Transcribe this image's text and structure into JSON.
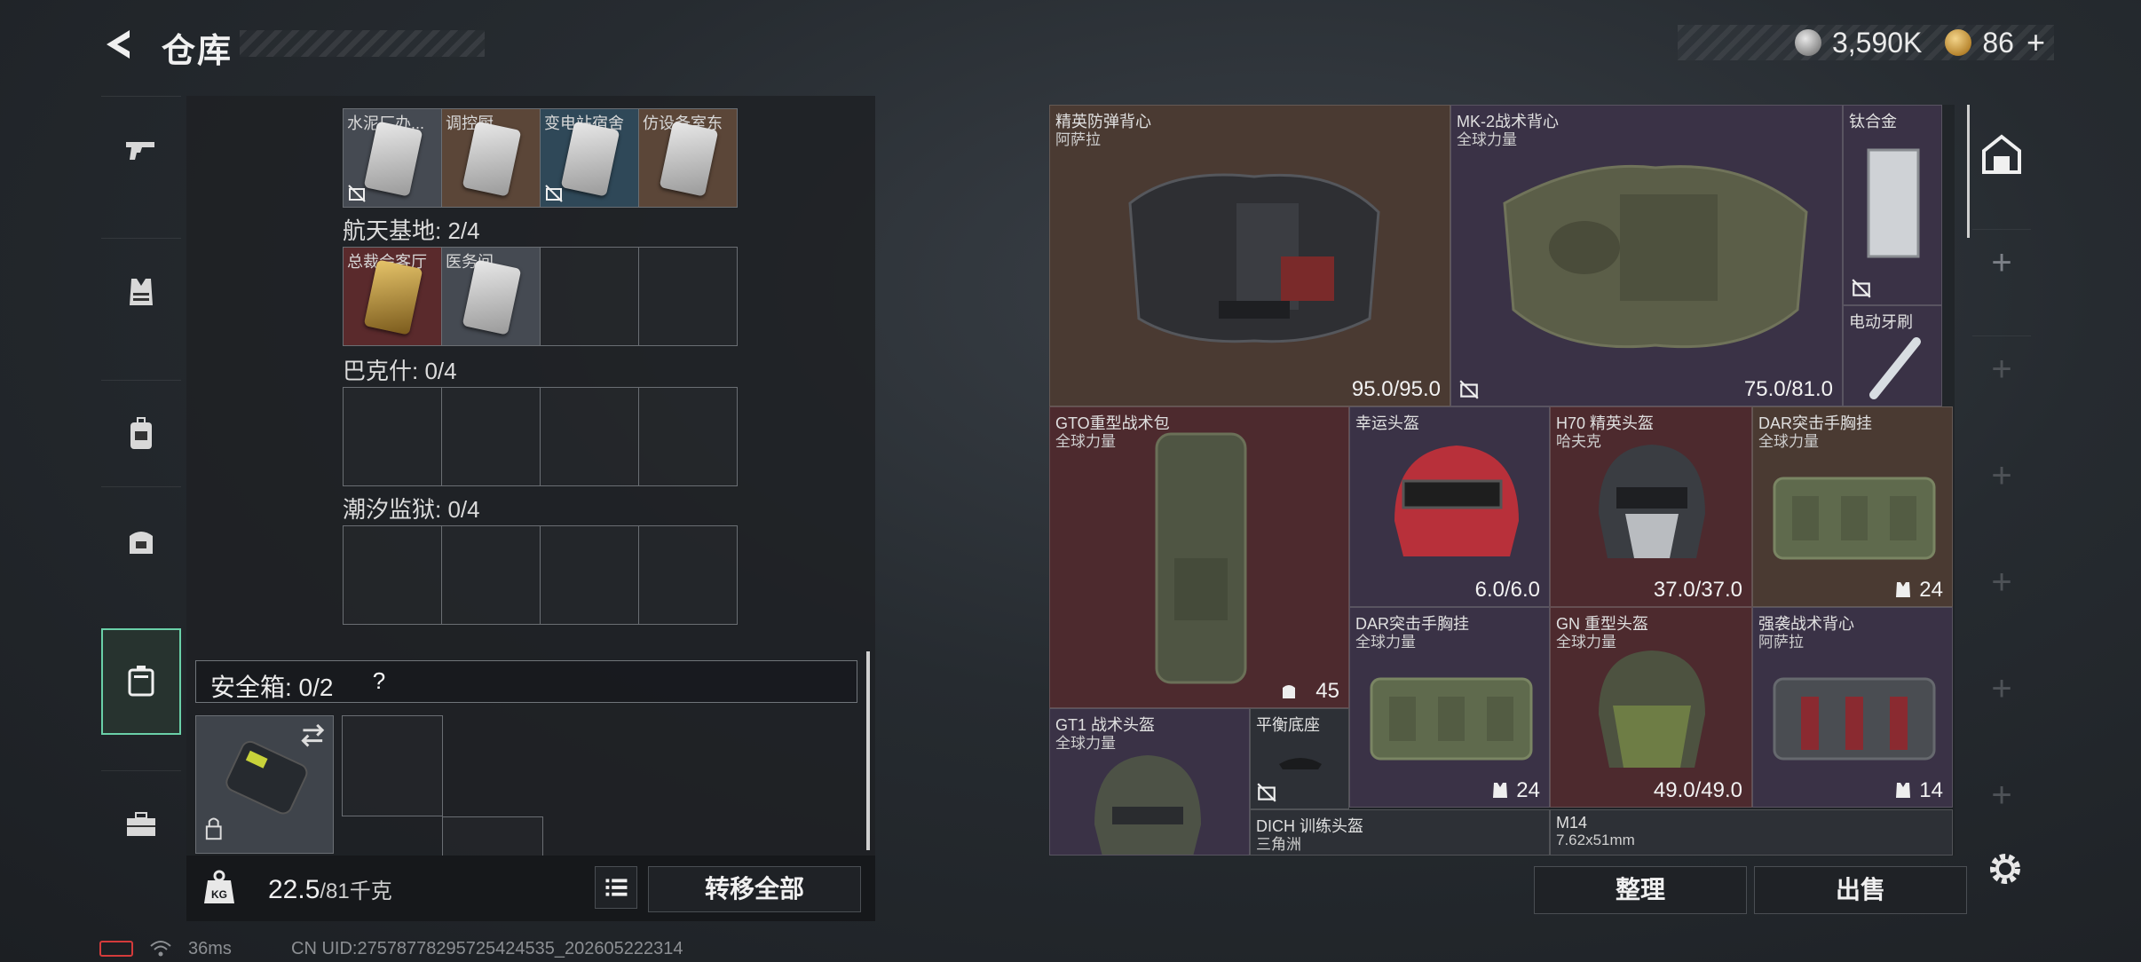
{
  "header": {
    "title": "仓库",
    "currency_silver": "3,590K",
    "currency_gold": "86",
    "currency_plus": "+"
  },
  "sidebar": {
    "items": [
      {
        "icon": "pistol-icon"
      },
      {
        "icon": "vest-icon"
      },
      {
        "icon": "backpack-icon"
      },
      {
        "icon": "bag-icon"
      },
      {
        "icon": "safe-box-icon",
        "active": true
      },
      {
        "icon": "toolbox-icon"
      }
    ]
  },
  "keycards": {
    "row1": [
      "水泥厂办...",
      "调控厨",
      "变电站宿舍",
      "仿设备室东"
    ],
    "space_base_label": "航天基地: 2/4",
    "row2": [
      "总裁会客厅",
      "医务间",
      "",
      ""
    ],
    "bakesh_label": "巴克什: 0/4",
    "prison_label": "潮汐监狱: 0/4"
  },
  "safe_box": {
    "label": "安全箱:  0/2",
    "help": "?"
  },
  "bottom_left": {
    "weight_value": "22.5",
    "weight_unit": "/81千克",
    "transfer_all": "转移全部"
  },
  "inventory": {
    "items": [
      {
        "name": "精英防弹背心",
        "sub": "阿萨拉",
        "durability": "95.0/95.0"
      },
      {
        "name": "MK-2战术背心",
        "sub": "全球力量",
        "durability": "75.0/81.0"
      },
      {
        "name": "钛合金",
        "sub": ""
      },
      {
        "name": "电动牙刷",
        "sub": ""
      },
      {
        "name": "GTO重型战术包",
        "sub": "全球力量",
        "count": "45"
      },
      {
        "name": "幸运头盔",
        "sub": "",
        "durability": "6.0/6.0"
      },
      {
        "name": "H70 精英头盔",
        "sub": "哈夫克",
        "durability": "37.0/37.0"
      },
      {
        "name": "DAR突击手胸挂",
        "sub": "全球力量",
        "count": "24"
      },
      {
        "name": "DAR突击手胸挂",
        "sub": "全球力量",
        "count": "24"
      },
      {
        "name": "GN 重型头盔",
        "sub": "全球力量",
        "durability": "49.0/49.0"
      },
      {
        "name": "强袭战术背心",
        "sub": "阿萨拉",
        "count": "14"
      },
      {
        "name": "GT1 战术头盔",
        "sub": "全球力量"
      },
      {
        "name": "平衡底座",
        "sub": ""
      },
      {
        "name": "DICH 训练头盔",
        "sub": "三角洲"
      },
      {
        "name": "M14",
        "sub": "7.62x51mm"
      }
    ]
  },
  "bottom_right": {
    "sort": "整理",
    "sell": "出售"
  },
  "status": {
    "ping": "36ms",
    "uid": "CN UID:27578778295725424535_202605222314"
  }
}
